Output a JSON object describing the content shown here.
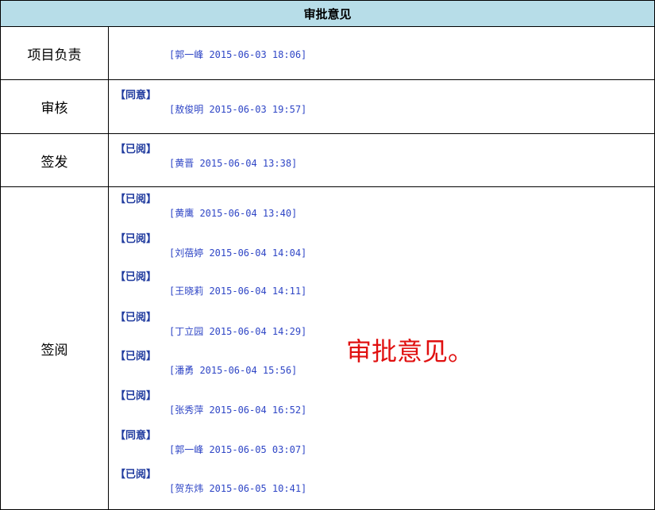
{
  "table": {
    "title": "审批意见",
    "rows": [
      {
        "label": "项目负责",
        "entries": [
          {
            "verdict": "",
            "signature": "[郭一峰 2015-06-03 18:06]"
          }
        ]
      },
      {
        "label": "审核",
        "entries": [
          {
            "verdict": "【同意】",
            "signature": "[敖俊明 2015-06-03 19:57]"
          }
        ]
      },
      {
        "label": "签发",
        "entries": [
          {
            "verdict": "【已阅】",
            "signature": "[黄晋 2015-06-04 13:38]"
          }
        ]
      },
      {
        "label": "签阅",
        "entries": [
          {
            "verdict": "【已阅】",
            "signature": "[黄鹰 2015-06-04 13:40]"
          },
          {
            "verdict": "【已阅】",
            "signature": "[刘蓓婷 2015-06-04 14:04]"
          },
          {
            "verdict": "【已阅】",
            "signature": "[王晓莉 2015-06-04 14:11]"
          },
          {
            "verdict": "【已阅】",
            "signature": "[丁立园 2015-06-04 14:29]"
          },
          {
            "verdict": "【已阅】",
            "signature": "[潘勇 2015-06-04 15:56]"
          },
          {
            "verdict": "【已阅】",
            "signature": "[张秀萍 2015-06-04 16:52]"
          },
          {
            "verdict": "【同意】",
            "signature": "[郭一峰 2015-06-05 03:07]"
          },
          {
            "verdict": "【已阅】",
            "signature": "[贺东炜 2015-06-05 10:41]"
          }
        ]
      }
    ]
  },
  "annotation": "审批意见。"
}
